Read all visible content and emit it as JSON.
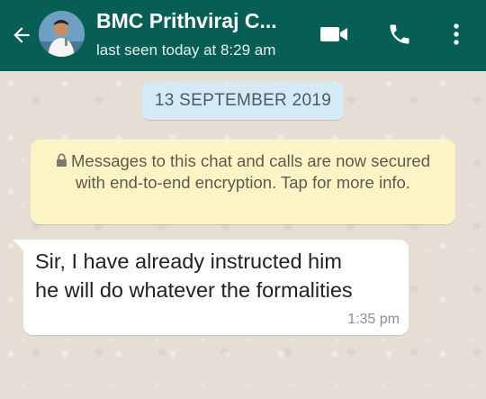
{
  "header": {
    "contact_name": "BMC Prithviraj C...",
    "status": "last seen today at 8:29 am",
    "back_icon": "arrow-left-icon",
    "video_icon": "video-camera-icon",
    "call_icon": "phone-icon",
    "menu_icon": "more-vertical-icon",
    "bar_color": "#075e54"
  },
  "chat": {
    "date_separator": "13 SEPTEMBER 2019",
    "encryption_notice": "Messages to this chat and calls are now secured with end-to-end encryption. Tap for more info.",
    "messages": [
      {
        "direction": "incoming",
        "lines": [
          "Sir, I have already instructed him",
          "he will do whatever the formalities"
        ],
        "time": "1:35 pm"
      }
    ]
  },
  "colors": {
    "wallpaper": "#e6ded5",
    "date_chip": "#d4eaf4",
    "notice": "#fdf4c5",
    "bubble": "#ffffff"
  }
}
